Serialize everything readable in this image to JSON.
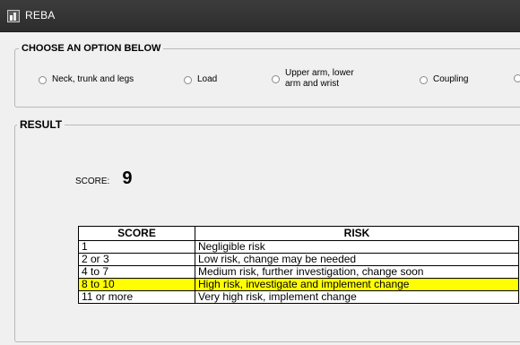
{
  "window": {
    "title": "REBA"
  },
  "options": {
    "legend": "CHOOSE AN OPTION BELOW",
    "items": [
      {
        "label": "Neck, trunk and legs"
      },
      {
        "label": "Load"
      },
      {
        "label_line1": "Upper arm, lower",
        "label_line2": "arm and wrist"
      },
      {
        "label": "Coupling"
      }
    ]
  },
  "result": {
    "legend": "RESULT",
    "score_label": "SCORE:",
    "score_value": "9"
  },
  "risk_table": {
    "headers": [
      "SCORE",
      "RISK"
    ],
    "rows": [
      {
        "score": "1",
        "risk": "Negligible risk"
      },
      {
        "score": "2 or 3",
        "risk": "Low risk, change may be needed"
      },
      {
        "score": "4 to 7",
        "risk": "Medium risk, further investigation, change soon"
      },
      {
        "score": "8 to 10",
        "risk": "High risk, investigate and implement change"
      },
      {
        "score": "11 or more",
        "risk": "Very high risk, implement change"
      }
    ],
    "highlight_color": "#ffff00"
  },
  "colors": {
    "titlebar": "#2d2d2d",
    "background": "#f0f0f0"
  }
}
